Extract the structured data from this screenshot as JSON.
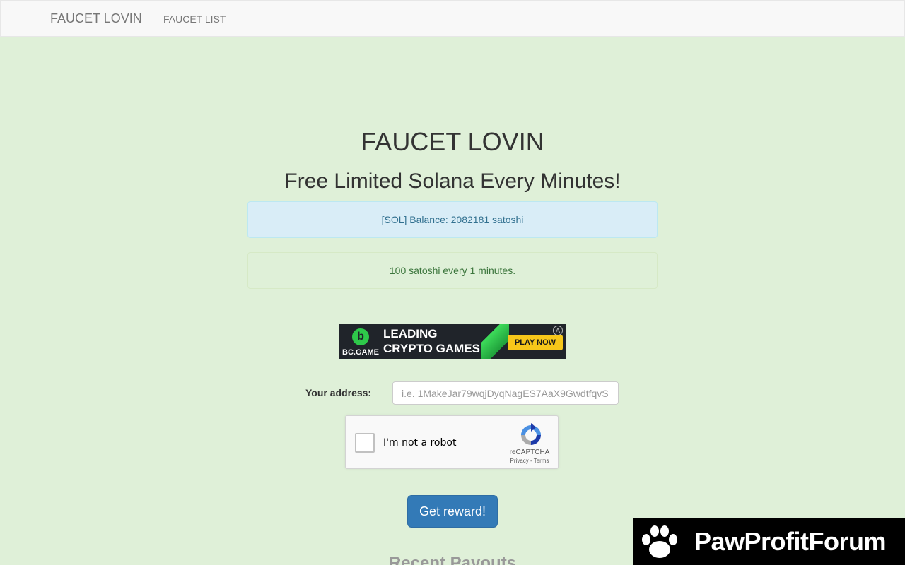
{
  "navbar": {
    "brand": "FAUCET LOVIN",
    "links": [
      {
        "label": "FAUCET LIST"
      }
    ]
  },
  "main": {
    "title": "FAUCET LOVIN",
    "subtitle": "Free Limited Solana Every Minutes!",
    "balance_text": "[SOL] Balance: 2082181 satoshi",
    "rate_text": "100 satoshi every 1 minutes."
  },
  "ad": {
    "brand": "BC.GAME",
    "headline_line1": "LEADING",
    "headline_line2": "CRYPTO GAMES",
    "cta": "PLAY NOW",
    "adchoice_icon": "adchoices-icon",
    "colors": {
      "background": "#20242a",
      "accent": "#2ec84a",
      "cta": "#f7c71a"
    }
  },
  "form": {
    "address_label": "Your address:",
    "address_value": "",
    "address_placeholder": "i.e. 1MakeJar79wqjDyqNagES7AaX9GwdtfqvS",
    "captcha": {
      "label": "I'm not a robot",
      "brand": "reCAPTCHA",
      "terms": "Privacy - Terms"
    },
    "submit_label": "Get reward!"
  },
  "payouts": {
    "title": "Recent Payouts"
  },
  "overlay": {
    "text": "PawProfitForum",
    "icon": "paw-icon"
  },
  "colors": {
    "page_background": "#dff0d8",
    "primary_button": "#337ab7",
    "info_alert": "#d9edf7",
    "success_text": "#3c763d"
  }
}
